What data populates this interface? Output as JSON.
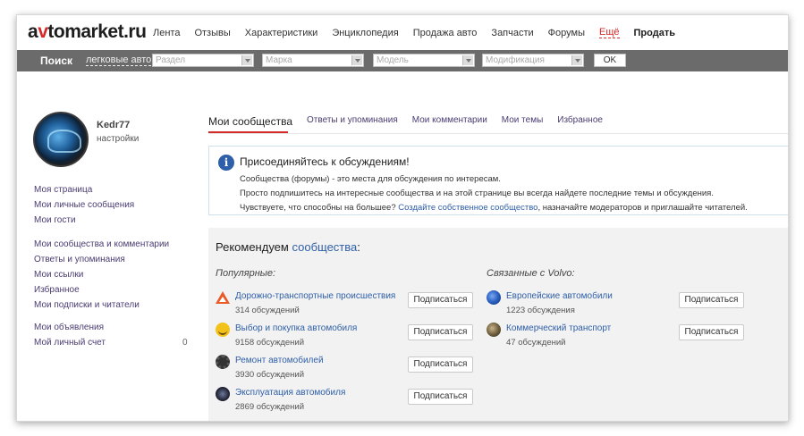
{
  "header": {
    "logo_prefix": "a",
    "logo_v": "v",
    "logo_suffix": "tomarket.ru",
    "nav": [
      "Лента",
      "Отзывы",
      "Характеристики",
      "Энциклопедия",
      "Продажа авто",
      "Запчасти",
      "Форумы"
    ],
    "more_label": "Ещё",
    "sell_label": "Продать"
  },
  "search": {
    "label": "Поиск",
    "category": "легковые авто",
    "section_placeholder": "Раздел",
    "brand_placeholder": "Марка",
    "model_placeholder": "Модель",
    "modification_placeholder": "Модификация",
    "ok_label": "OK"
  },
  "profile": {
    "username": "Kedr77",
    "settings": "настройки"
  },
  "sidebar": {
    "group1": [
      "Моя страница",
      "Мои личные сообщения",
      "Мои гости"
    ],
    "group2": [
      "Мои сообщества и комментарии",
      "Ответы и упоминания",
      "Мои ссылки",
      "Избранное",
      "Мои подписки и читатели"
    ],
    "group3": [
      "Мои объявления",
      "Мой личный счет"
    ],
    "account_balance": "0"
  },
  "tabs": [
    "Мои сообщества",
    "Ответы и упоминания",
    "Мои комментарии",
    "Мои темы",
    "Избранное"
  ],
  "info": {
    "title": "Присоединяйтесь к обсуждениям!",
    "line1": "Сообщества (форумы) - это места для обсуждения по интересам.",
    "line2": "Просто подпишитесь на интересные сообщества и на этой странице вы всегда найдете последние темы и обсуждения.",
    "line3_pre": "Чувствуете, что способны на большее? ",
    "line3_link": "Создайте собственное сообщество",
    "line3_post": ", назначайте модераторов и приглашайте читателей."
  },
  "recommend": {
    "title_pre": "Рекомендуем ",
    "title_link": "сообщества",
    "title_post": ":",
    "popular_heading": "Популярные:",
    "related_heading": "Связанные с Volvo:",
    "subscribe_label": "Подписаться",
    "popular": [
      {
        "name": "Дорожно-транспортные происшествия",
        "count": "314 обсуждений",
        "icon": "warning-triangle-icon"
      },
      {
        "name": "Выбор и покупка автомобиля",
        "count": "9158 обсуждений",
        "icon": "smile-icon"
      },
      {
        "name": "Ремонт автомобилей",
        "count": "3930 обсуждений",
        "icon": "gear-icon"
      },
      {
        "name": "Эксплуатация автомобиля",
        "count": "2869 обсуждений",
        "icon": "car-dark-icon"
      }
    ],
    "related": [
      {
        "name": "Европейские автомобили",
        "count": "1223 обсуждения",
        "icon": "globe-icon"
      },
      {
        "name": "Коммерческий транспорт",
        "count": "47 обсуждений",
        "icon": "truck-icon"
      }
    ]
  }
}
